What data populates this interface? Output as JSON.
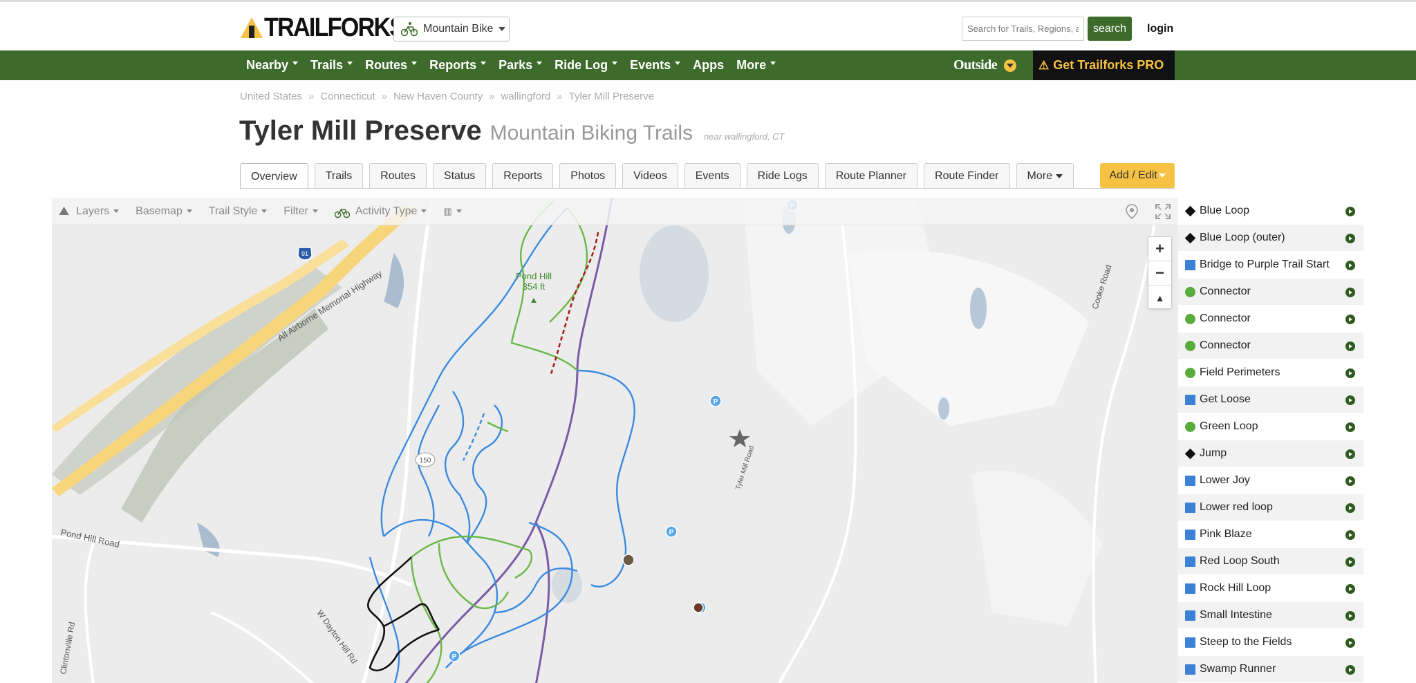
{
  "header": {
    "logo_text": "TRAILFORKS",
    "activity": "Mountain Bike",
    "search_placeholder": "Search for Trails, Regions, a",
    "search_label": "search",
    "login_label": "login"
  },
  "nav": {
    "items": [
      "Nearby",
      "Trails",
      "Routes",
      "Reports",
      "Parks",
      "Ride Log",
      "Events",
      "Apps",
      "More"
    ],
    "outside_label": "Outside",
    "pro_label": "Get Trailforks PRO"
  },
  "breadcrumb": [
    "United States",
    "Connecticut",
    "New Haven County",
    "wallingford",
    "Tyler Mill Preserve"
  ],
  "page": {
    "title": "Tyler Mill Preserve",
    "subtitle": "Mountain Biking Trails",
    "near_prefix": "near",
    "near_location": "wallingford, CT"
  },
  "tabs": [
    "Overview",
    "Trails",
    "Routes",
    "Status",
    "Reports",
    "Photos",
    "Videos",
    "Events",
    "Ride Logs",
    "Route Planner",
    "Route Finder",
    "More"
  ],
  "add_edit_label": "Add / Edit",
  "map": {
    "toolbar": [
      "Layers",
      "Basemap",
      "Trail Style",
      "Filter",
      "Activity Type"
    ],
    "labels": {
      "pond_hill": "Pond Hill",
      "pond_hill_elev": "354 ft",
      "highway": "All Airborne Memorial Highway",
      "pond_hill_road": "Pond Hill Road",
      "clintonville": "Clintonville Rd",
      "dayton": "W Dayton Hill Rd",
      "cooke": "Cooke Road",
      "route150": "150",
      "i91": "91",
      "tyler_mill_road": "Tyler Mill Road"
    }
  },
  "trails": [
    {
      "name": "Blue Loop",
      "difficulty": "black"
    },
    {
      "name": "Blue Loop (outer)",
      "difficulty": "black"
    },
    {
      "name": "Bridge to Purple Trail Start",
      "difficulty": "blue"
    },
    {
      "name": "Connector",
      "difficulty": "green"
    },
    {
      "name": "Connector",
      "difficulty": "green"
    },
    {
      "name": "Connector",
      "difficulty": "green"
    },
    {
      "name": "Field Perimeters",
      "difficulty": "green"
    },
    {
      "name": "Get Loose",
      "difficulty": "blue"
    },
    {
      "name": "Green Loop",
      "difficulty": "green"
    },
    {
      "name": "Jump",
      "difficulty": "black"
    },
    {
      "name": "Lower Joy",
      "difficulty": "blue"
    },
    {
      "name": "Lower red loop",
      "difficulty": "blue"
    },
    {
      "name": "Pink Blaze",
      "difficulty": "blue"
    },
    {
      "name": "Red Loop South",
      "difficulty": "blue"
    },
    {
      "name": "Rock Hill Loop",
      "difficulty": "blue"
    },
    {
      "name": "Small Intestine",
      "difficulty": "blue"
    },
    {
      "name": "Steep to the Fields",
      "difficulty": "blue"
    },
    {
      "name": "Swamp Runner",
      "difficulty": "blue"
    }
  ]
}
